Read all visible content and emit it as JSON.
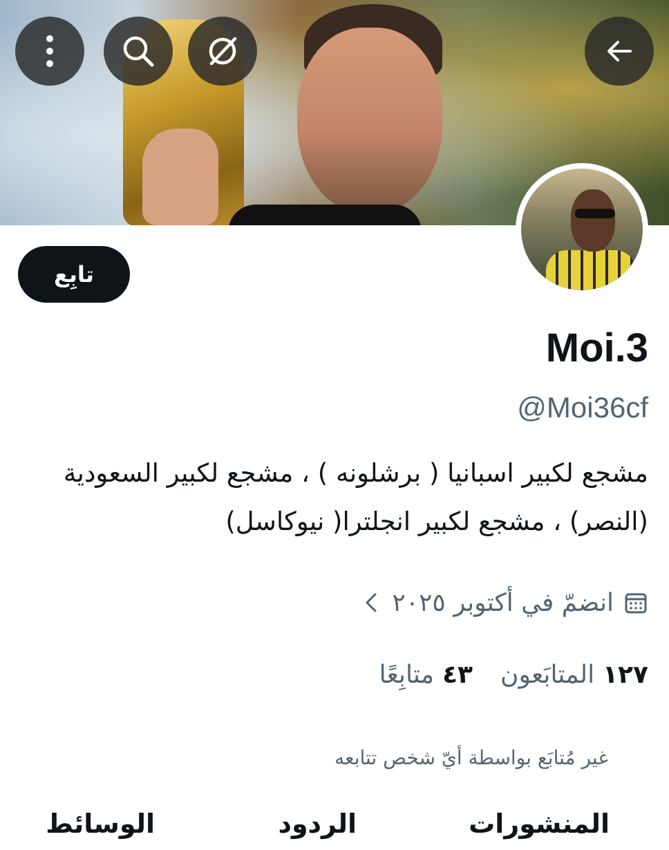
{
  "header": {
    "back_icon": "arrow-left-icon",
    "more_icon": "more-vertical-icon",
    "search_icon": "search-icon",
    "grok_icon": "grok-icon"
  },
  "profile": {
    "display_name": "Moi.3",
    "handle": "@Moi36cf",
    "bio_line1": "مشجع لكبير اسبانيا ( برشلونه ) ، مشجع لكبير السعودية",
    "bio_line2": "(النصر) ، مشجع لكبير انجلترا( نيوكاسل)",
    "joined": "انضمّ في أكتوبر ٢٠٢٥",
    "following_count": "٤٣",
    "following_label": "متابِعًا",
    "followers_count": "١٢٧",
    "followers_label": "المتابَعون",
    "not_followed_notice": "غير مُتابَع بواسطة أيّ شخص تتابعه"
  },
  "actions": {
    "follow_label": "تابِع"
  },
  "tabs": [
    {
      "label": "المنشورات"
    },
    {
      "label": "الردود"
    },
    {
      "label": "الوسائط"
    }
  ],
  "colors": {
    "text_primary": "#0f1419",
    "text_secondary": "#536471",
    "button_bg": "#0f1419"
  }
}
